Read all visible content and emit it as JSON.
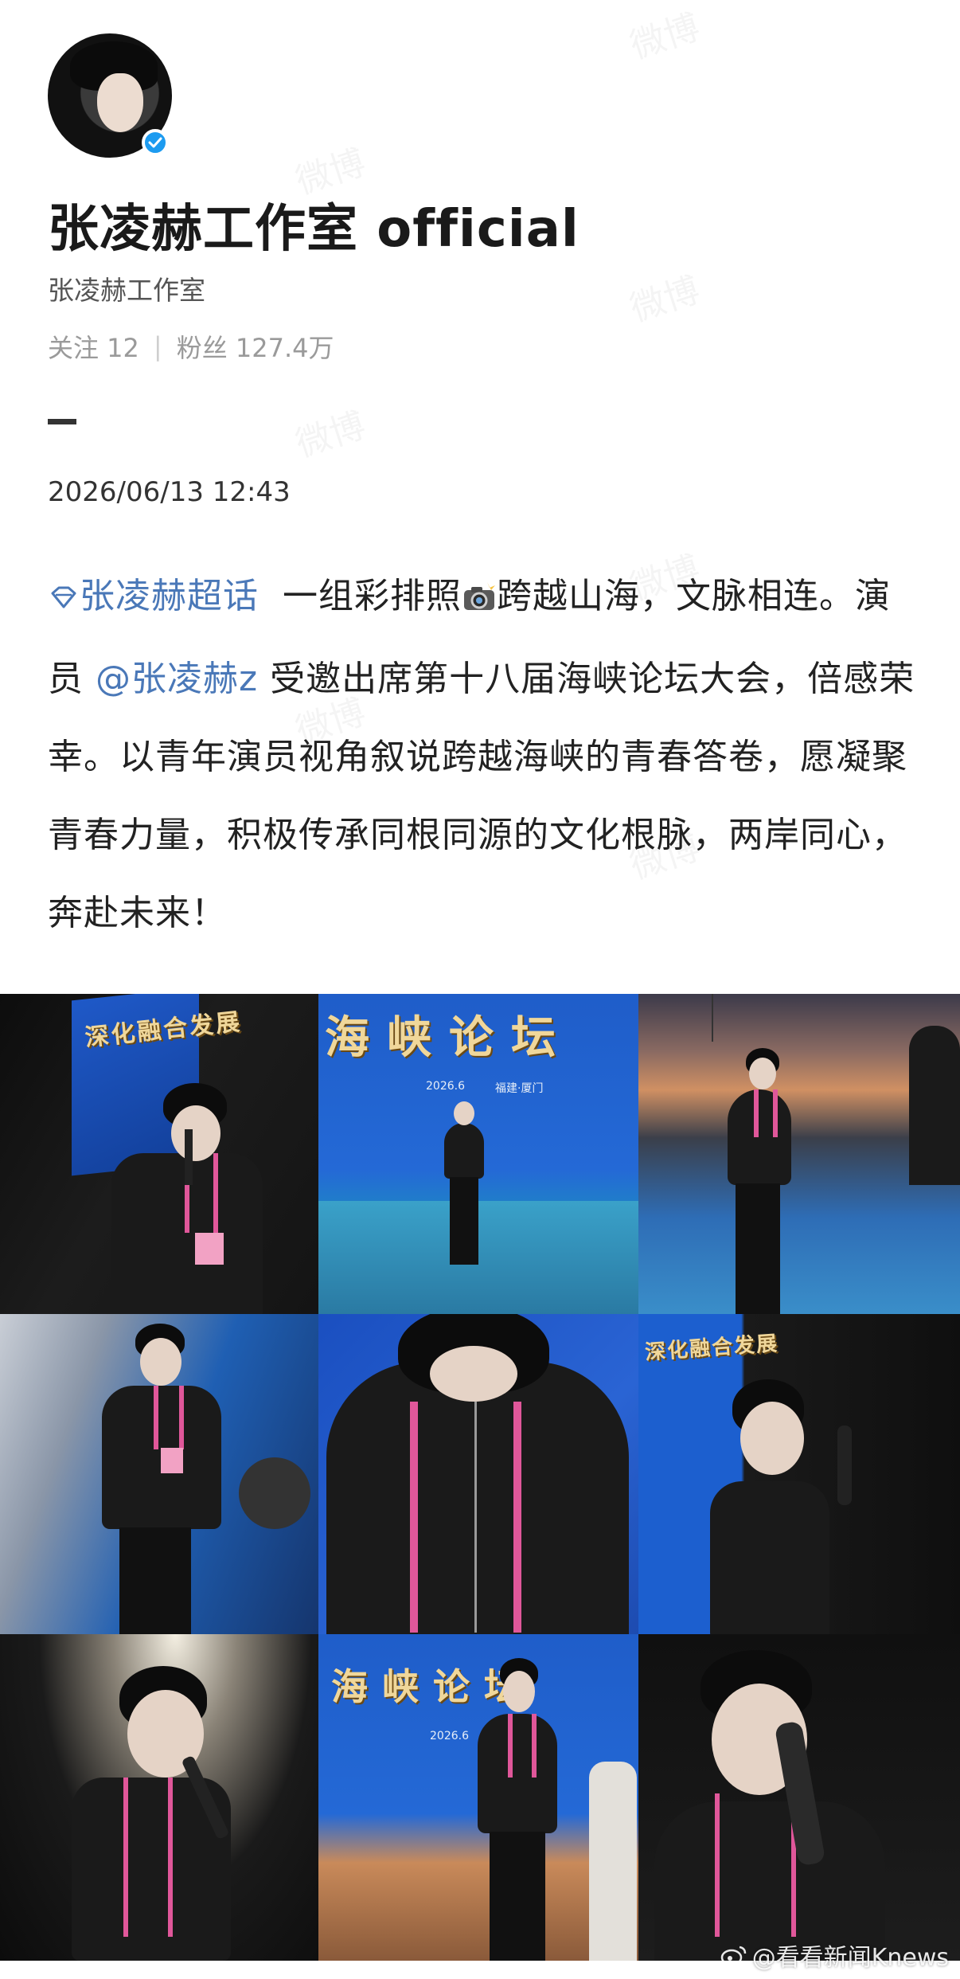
{
  "profile": {
    "name": "张凌赫工作室 official",
    "subtitle": "张凌赫工作室",
    "following_label": "关注 12",
    "followers_label": "粉丝 127.4万",
    "verified": true
  },
  "post": {
    "timestamp": "2026/06/13 12:43",
    "topic": "张凌赫超话",
    "text_part1": "一组彩排照",
    "text_part2": "跨越山海，文脉相连。演员 ",
    "mention": "@张凌赫z",
    "text_part3": " 受邀出席第十八届海峡论坛大会，倍感荣幸。以青年演员视角叙说跨越海峡的青春答卷，愿凝聚青春力量，积极传承同根同源的文化根脉，两岸同心，奔赴未来！"
  },
  "photos": {
    "banner_a": "深化融合发展",
    "banner_b": "海峡论坛",
    "date_a": "2026.6",
    "place_a": "福建·厦门",
    "date_b": "2026.6"
  },
  "footer": {
    "source_watermark": "@看看新闻Knews"
  },
  "watermark_text": "微博"
}
